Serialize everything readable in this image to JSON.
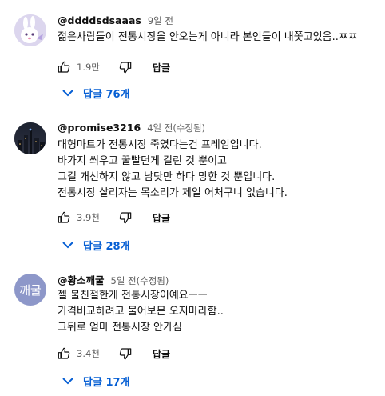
{
  "comments": [
    {
      "author": "@ddddsdsaaas",
      "time": "9일 전",
      "lines": [
        "젊은사람들이 전통시장을 안오는게 아니라 본인들이 내쫓고있음..ㅉㅉ"
      ],
      "likes": "1.9만",
      "reply_label": "답글",
      "replies_label": "답글 76개"
    },
    {
      "author": "@promise3216",
      "time": "4일 전(수정됨)",
      "lines": [
        "대형마트가 전통시장 죽였다는건 프레임입니다.",
        "바가지 씌우고 꿀빨던게 걸린 것 뿐이고",
        "그걸 개선하지 않고 남탓만 하다 망한 것 뿐입니다.",
        "전통시장 살리자는 목소리가 제일 어처구니 없습니다."
      ],
      "likes": "3.9천",
      "reply_label": "답글",
      "replies_label": "답글 28개"
    },
    {
      "author": "@황소깨굴",
      "time": "5일 전(수정됨)",
      "avatar_text": "깨굴",
      "lines": [
        "젤 불친절한게 전통시장이예요ㅡㅡ",
        "가격비교하려고 물어보믄 오지마라함..",
        "그뒤로 엄마 전통시장 안가심"
      ],
      "likes": "3.4천",
      "reply_label": "답글",
      "replies_label": "답글 17개"
    }
  ],
  "icons": {
    "like": "thumbs-up-icon",
    "dislike": "thumbs-down-icon",
    "expand": "chevron-down-icon"
  },
  "colors": {
    "link_blue": "#065fd4",
    "secondary_text": "#606060",
    "avatar3_bg": "#8d97c9"
  }
}
